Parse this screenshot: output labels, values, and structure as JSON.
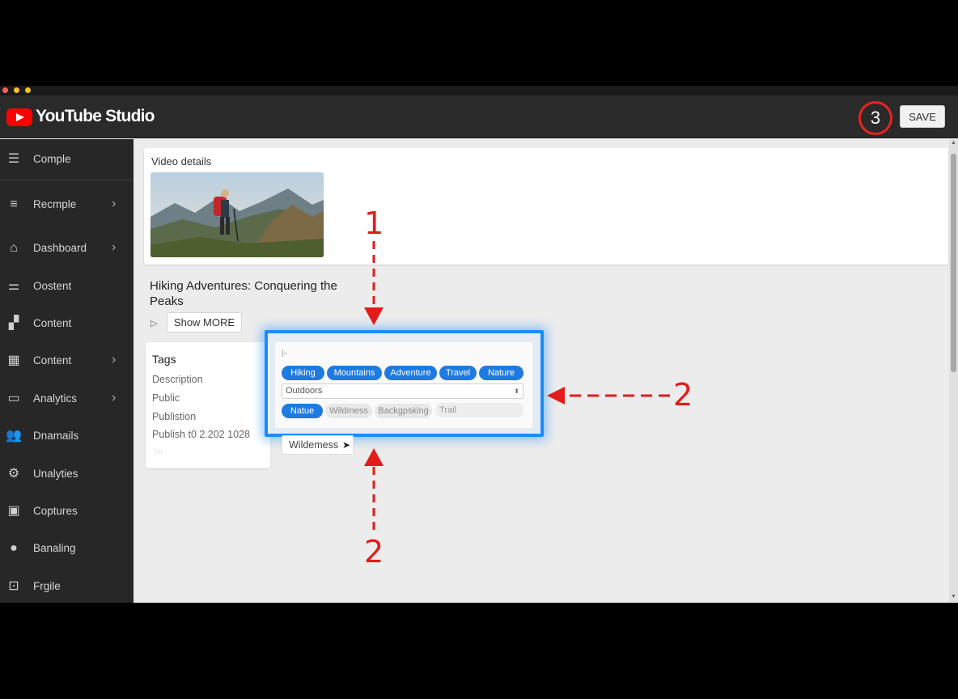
{
  "app": {
    "brand": "YouTube Studio"
  },
  "header": {
    "save_label": "SAVE",
    "step_badge": "3"
  },
  "sidebar": {
    "items": [
      {
        "label": "Comple",
        "icon": "list-icon",
        "chevron": false
      },
      {
        "label": "Recmple",
        "icon": "menu-icon",
        "chevron": true
      },
      {
        "label": "Dashboard",
        "icon": "home-icon",
        "chevron": true
      },
      {
        "label": "Oostent",
        "icon": "sliders-icon",
        "chevron": false
      },
      {
        "label": "Content",
        "icon": "group-icon",
        "chevron": false
      },
      {
        "label": "Content",
        "icon": "grid-icon",
        "chevron": true
      },
      {
        "label": "Analytics",
        "icon": "monitor-icon",
        "chevron": true
      },
      {
        "label": "Dnamails",
        "icon": "people-icon",
        "chevron": false
      },
      {
        "label": "Unalyties",
        "icon": "gear-icon",
        "chevron": false
      },
      {
        "label": "Coptures",
        "icon": "copyright-icon",
        "chevron": false
      },
      {
        "label": "Banaling",
        "icon": "person-icon",
        "chevron": false
      },
      {
        "label": "Frgile",
        "icon": "feedback-icon",
        "chevron": false
      }
    ]
  },
  "details": {
    "title": "Video details"
  },
  "video": {
    "title": "Hiking Adventures: Conquering the Peaks",
    "show_more": "Show MORE"
  },
  "tags_card": {
    "heading": "Tags",
    "rows": [
      "Description",
      "Public",
      "Publistion",
      "Publish t0 2.202 1028"
    ],
    "faint": "Tlo"
  },
  "tag_panel": {
    "hint": "|–",
    "chips": [
      "Hiking",
      "Mountains",
      "Adventure",
      "Travel",
      "Nature"
    ],
    "select_value": "Outdoors",
    "suggestions": [
      "Natue",
      "Wildmess",
      "Backgpsking"
    ],
    "input_value": "Trail"
  },
  "floating_chip": "Wildemess",
  "annotations": {
    "one": "1",
    "two_right": "2",
    "two_bottom": "2"
  },
  "colors": {
    "accent": "#1f7ae0",
    "annotation": "#e31b1b",
    "highlight": "#1a8cff",
    "brand_red": "#ff0000"
  }
}
